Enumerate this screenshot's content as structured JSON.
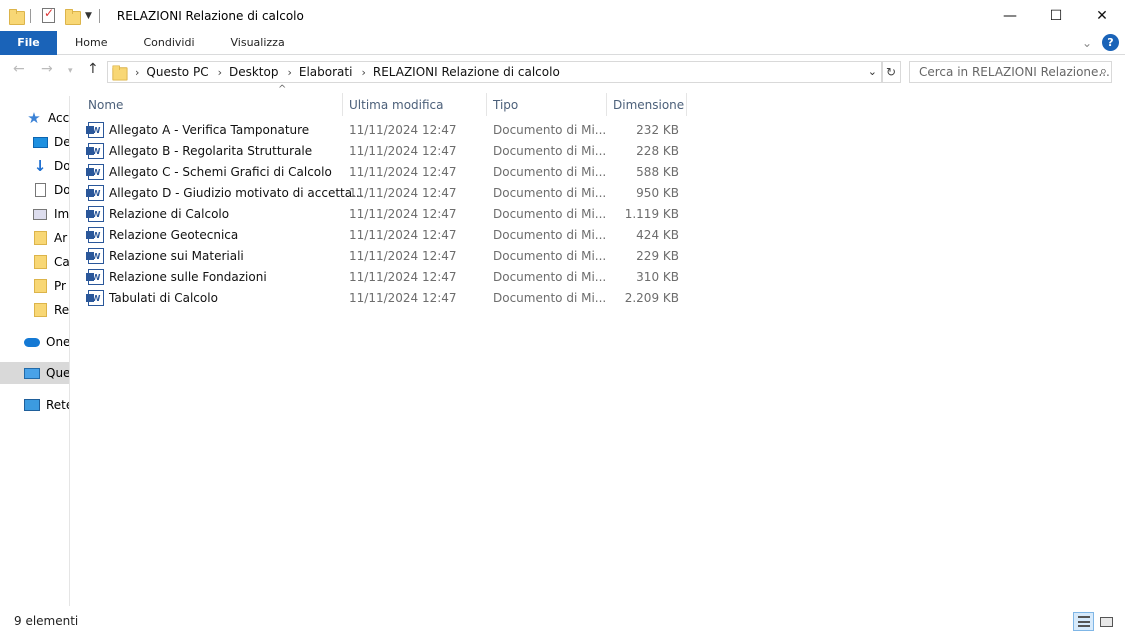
{
  "window": {
    "title": "RELAZIONI Relazione di calcolo",
    "minimize_glyph": "—",
    "maximize_glyph": "☐",
    "close_glyph": "✕"
  },
  "ribbon": {
    "file": "File",
    "tabs": [
      "Home",
      "Condividi",
      "Visualizza"
    ],
    "help_glyph": "?"
  },
  "address": {
    "crumbs": [
      "Questo PC",
      "Desktop",
      "Elaborati",
      "RELAZIONI Relazione di calcolo"
    ],
    "search_placeholder": "Cerca in RELAZIONI Relazione..."
  },
  "nav_pane": {
    "items": [
      {
        "label": "Acc",
        "icon": "star-icon"
      },
      {
        "label": "De",
        "icon": "desktop-icon"
      },
      {
        "label": "Do",
        "icon": "download-icon"
      },
      {
        "label": "Do",
        "icon": "document-icon"
      },
      {
        "label": "Im",
        "icon": "pictures-icon"
      },
      {
        "label": "Ar",
        "icon": "folder-icon"
      },
      {
        "label": "Ca",
        "icon": "folder-icon"
      },
      {
        "label": "Pr",
        "icon": "folder-icon"
      },
      {
        "label": "Re",
        "icon": "folder-icon"
      },
      {
        "label": "One",
        "icon": "onedrive-icon"
      },
      {
        "label": "Que",
        "icon": "this-pc-icon"
      },
      {
        "label": "Rete",
        "icon": "network-icon"
      }
    ]
  },
  "columns": {
    "name": "Nome",
    "modified": "Ultima modifica",
    "type": "Tipo",
    "size": "Dimensione"
  },
  "files": [
    {
      "name": "Allegato A - Verifica Tamponature",
      "modified": "11/11/2024 12:47",
      "type": "Documento di Mi...",
      "size": "232 KB"
    },
    {
      "name": "Allegato B - Regolarita Strutturale",
      "modified": "11/11/2024 12:47",
      "type": "Documento di Mi...",
      "size": "228 KB"
    },
    {
      "name": "Allegato C - Schemi Grafici di Calcolo",
      "modified": "11/11/2024 12:47",
      "type": "Documento di Mi...",
      "size": "588 KB"
    },
    {
      "name": "Allegato D - Giudizio motivato di accetta...",
      "modified": "11/11/2024 12:47",
      "type": "Documento di Mi...",
      "size": "950 KB"
    },
    {
      "name": "Relazione di Calcolo",
      "modified": "11/11/2024 12:47",
      "type": "Documento di Mi...",
      "size": "1.119 KB"
    },
    {
      "name": "Relazione Geotecnica",
      "modified": "11/11/2024 12:47",
      "type": "Documento di Mi...",
      "size": "424 KB"
    },
    {
      "name": "Relazione sui Materiali",
      "modified": "11/11/2024 12:47",
      "type": "Documento di Mi...",
      "size": "229 KB"
    },
    {
      "name": "Relazione sulle Fondazioni",
      "modified": "11/11/2024 12:47",
      "type": "Documento di Mi...",
      "size": "310 KB"
    },
    {
      "name": "Tabulati di Calcolo",
      "modified": "11/11/2024 12:47",
      "type": "Documento di Mi...",
      "size": "2.209 KB"
    }
  ],
  "status": {
    "count": "9 elementi"
  },
  "colors": {
    "accent": "#1a63b8",
    "header_text": "#4c607a"
  }
}
